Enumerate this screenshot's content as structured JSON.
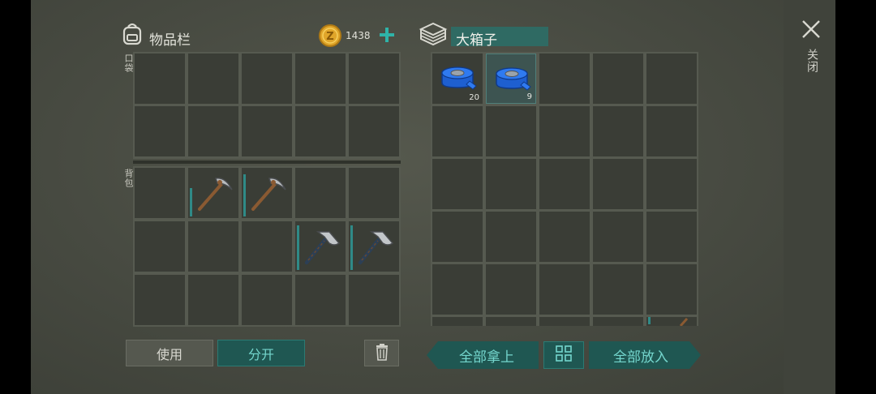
{
  "inventory": {
    "title": "物品栏",
    "coins": "1438",
    "pocket_label": "口袋",
    "backpack_label": "背包"
  },
  "chest": {
    "title": "大箱子",
    "items": [
      {
        "name": "blue-tape",
        "count": "20"
      },
      {
        "name": "blue-tape",
        "count": "9"
      }
    ]
  },
  "backpack_items": [
    {
      "name": "pickaxe",
      "durability": 0.6
    },
    {
      "name": "pickaxe",
      "durability": 0.9
    },
    {
      "name": "hatchet",
      "durability": 0.95
    },
    {
      "name": "hatchet",
      "durability": 0.95
    }
  ],
  "buttons": {
    "use": "使用",
    "split": "分开",
    "take_all": "全部拿上",
    "put_all": "全部放入",
    "close": "关闭"
  },
  "icons": {
    "backpack": "backpack-icon",
    "coin": "coin-icon",
    "plus": "plus-icon",
    "chest": "chest-icon",
    "trash": "trash-icon",
    "sort": "sort-grid-icon",
    "close": "close-icon"
  },
  "colors": {
    "accent": "#74d6cd",
    "teal_button": "#1f5752",
    "coin": "#e0a52a"
  }
}
